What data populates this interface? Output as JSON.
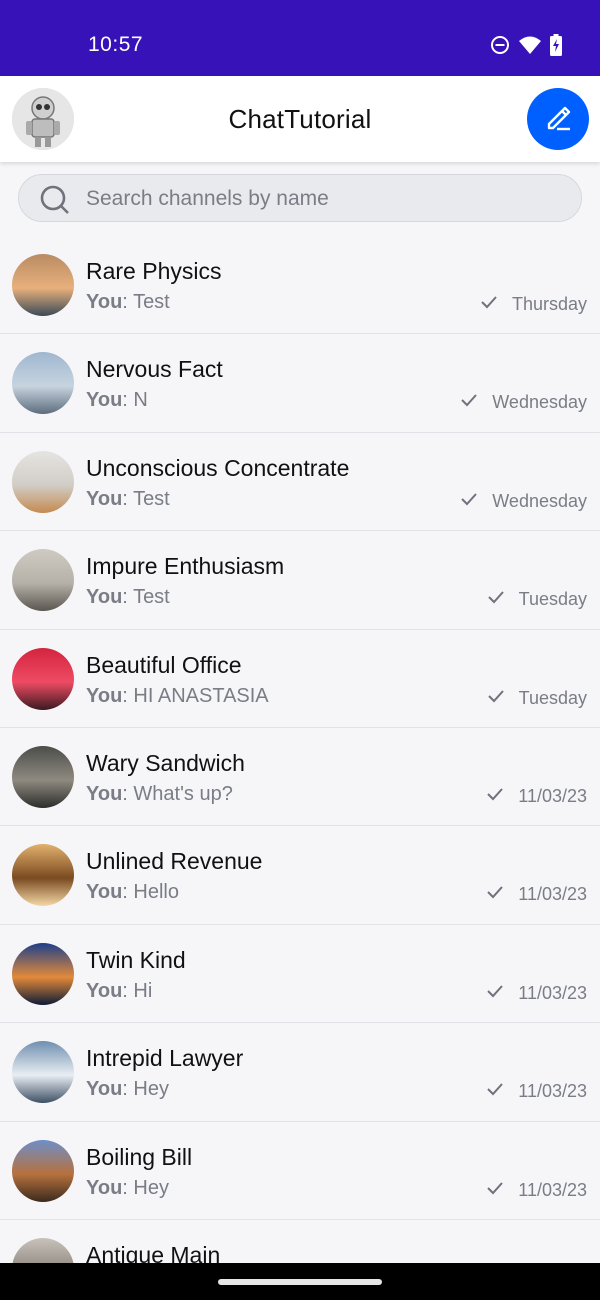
{
  "status_bar": {
    "time": "10:57",
    "icons": [
      "do-not-disturb-icon",
      "wifi-icon",
      "battery-charging-icon"
    ],
    "background": "#3612b8"
  },
  "app_bar": {
    "title": "ChatTutorial",
    "accent": "#005fff"
  },
  "search": {
    "placeholder": "Search channels by name"
  },
  "channels": [
    {
      "name": "Rare Physics",
      "sender": "You",
      "message": "Test",
      "date": "Thursday",
      "avatar_colors": [
        "#b98b63",
        "#e8b07c",
        "#3b4a57"
      ]
    },
    {
      "name": "Nervous Fact",
      "sender": "You",
      "message": "N",
      "date": "Wednesday",
      "avatar_colors": [
        "#9fb7cf",
        "#c7d4df",
        "#5d6d7d"
      ]
    },
    {
      "name": "Unconscious Concentrate",
      "sender": "You",
      "message": "Test",
      "date": "Wednesday",
      "avatar_colors": [
        "#e6e4e1",
        "#d1cdc7",
        "#c48a4f"
      ]
    },
    {
      "name": "Impure Enthusiasm",
      "sender": "You",
      "message": "Test",
      "date": "Tuesday",
      "avatar_colors": [
        "#cfcac2",
        "#b6b1a8",
        "#5a5650"
      ]
    },
    {
      "name": "Beautiful Office",
      "sender": "You",
      "message": "HI ANASTASIA",
      "date": "Tuesday",
      "avatar_colors": [
        "#d3243f",
        "#ef4b64",
        "#3a1a1f"
      ]
    },
    {
      "name": "Wary Sandwich",
      "sender": "You",
      "message": "What's up?",
      "date": "11/03/23",
      "avatar_colors": [
        "#4b4d4a",
        "#8f8a80",
        "#2c2d2a"
      ]
    },
    {
      "name": "Unlined Revenue",
      "sender": "You",
      "message": "Hello",
      "date": "11/03/23",
      "avatar_colors": [
        "#e2b06e",
        "#7a4a20",
        "#f4d8a6"
      ]
    },
    {
      "name": "Twin Kind",
      "sender": "You",
      "message": "Hi",
      "date": "11/03/23",
      "avatar_colors": [
        "#1d3f8a",
        "#e38a3a",
        "#0e1b36"
      ]
    },
    {
      "name": "Intrepid Lawyer",
      "sender": "You",
      "message": "Hey",
      "date": "11/03/23",
      "avatar_colors": [
        "#6f8fb0",
        "#e9eef3",
        "#3e5064"
      ]
    },
    {
      "name": "Boiling Bill",
      "sender": "You",
      "message": "Hey",
      "date": "11/03/23",
      "avatar_colors": [
        "#6d8fc9",
        "#b7713d",
        "#3b2a1d"
      ]
    },
    {
      "name": "Antique Main",
      "sender": "",
      "message": "",
      "date": "",
      "avatar_colors": [
        "#c8c2bb",
        "#8c857d",
        "#5a544e"
      ]
    }
  ]
}
